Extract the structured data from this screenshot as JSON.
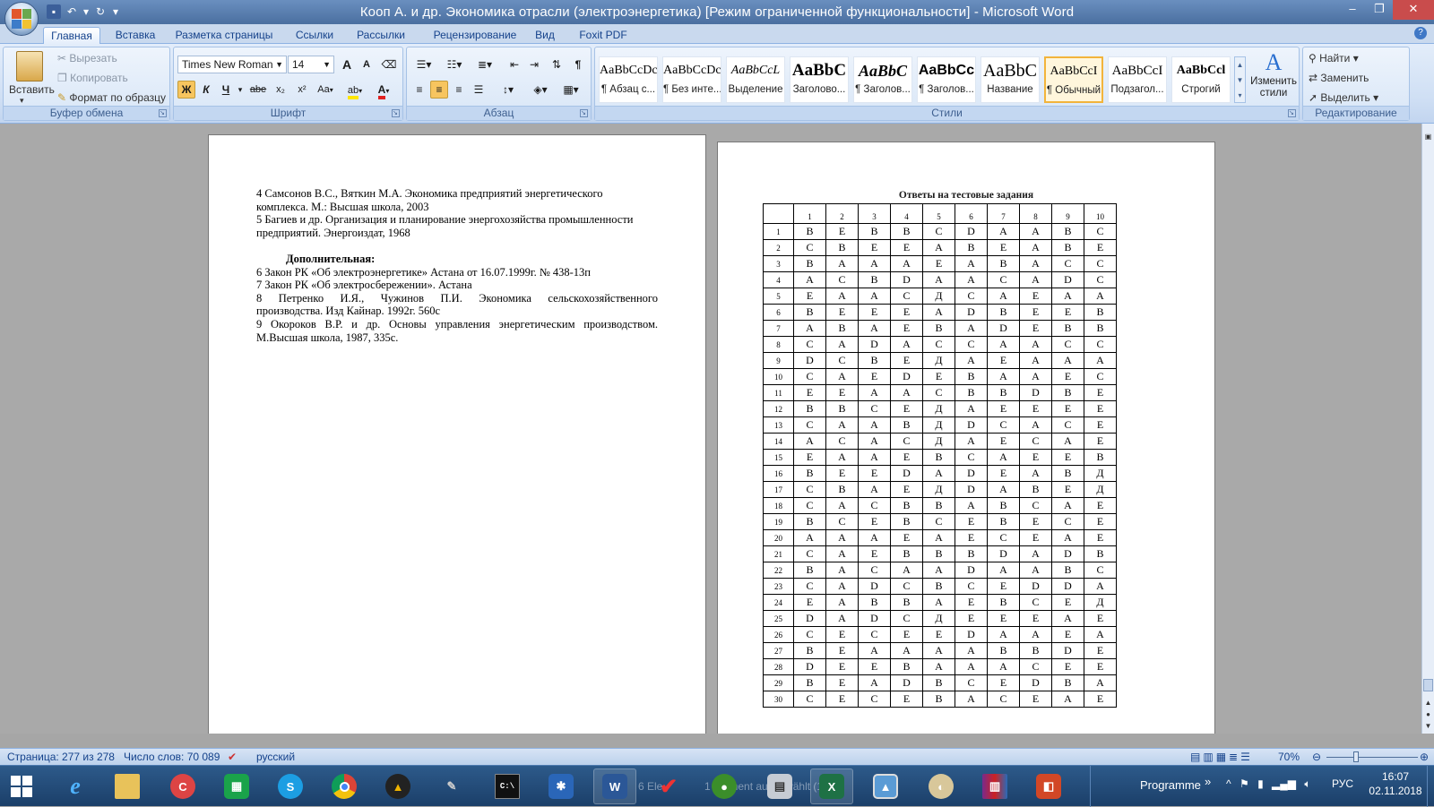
{
  "window": {
    "title": "Кооп А. и др. Экономика отрасли (электроэнергетика) [Режим ограниченной функциональности] - Microsoft Word",
    "buttons": [
      "–",
      "❐",
      "✕"
    ]
  },
  "tabs": [
    "Главная",
    "Вставка",
    "Разметка страницы",
    "Ссылки",
    "Рассылки",
    "Рецензирование",
    "Вид",
    "Foxit PDF"
  ],
  "clipboard": {
    "paste": "Вставить",
    "cut": "Вырезать",
    "copy": "Копировать",
    "format_painter": "Формат по образцу",
    "label": "Буфер обмена"
  },
  "font": {
    "name": "Times New Roman",
    "size": "14",
    "label": "Шрифт",
    "bold": "Ж",
    "italic": "К",
    "underline": "Ч",
    "strike": "abe",
    "sub": "x₂",
    "sup": "x²",
    "case": "Aa",
    "grow": "A",
    "shrink": "A"
  },
  "paragraph": {
    "label": "Абзац",
    "pilcrow": "¶"
  },
  "styles": {
    "label": "Стили",
    "items": [
      {
        "preview": "AaBbCcDc",
        "name": "¶ Абзац с..."
      },
      {
        "preview": "AaBbCcDc",
        "name": "¶ Без инте..."
      },
      {
        "preview": "AaBbCcL",
        "name": "Выделение"
      },
      {
        "preview": "AaBbC",
        "name": "Заголово..."
      },
      {
        "preview": "AaBbC",
        "name": "¶ Заголов..."
      },
      {
        "preview": "AaBbCc",
        "name": "¶ Заголов..."
      },
      {
        "preview": "AaBbC",
        "name": "Название"
      },
      {
        "preview": "AaBbCcI",
        "name": "¶ Обычный"
      },
      {
        "preview": "AaBbCcI",
        "name": "Подзагол..."
      },
      {
        "preview": "AaBbCcl",
        "name": "Строгий"
      }
    ],
    "change_styles": "Изменить стили"
  },
  "editing": {
    "label": "Редактирование",
    "find": "Найти",
    "replace": "Заменить",
    "select": "Выделить"
  },
  "left_page": {
    "line1": "4 Самсонов В.С., Вяткин М.А. Экономика предприятий энергетического",
    "line2": "комплекса. М.: Высшая школа, 2003",
    "line3": "5 Багиев и др. Организация и планирование энергохозяйства промышленности",
    "line4": "предприятий. Энергоиздат, 1968",
    "heading": "Дополнительная:",
    "line6": "6 Закон РК «Об электроэнергетике» Астана от 16.07.1999г. № 438-13п",
    "line7": "7 Закон РК «Об электросбережении». Астана",
    "line8a": "8 Петренко И.Я., Чужинов П.И. Экономика сельскохозяйственного",
    "line8b": "производства. Изд Кайнар. 1992г. 560с",
    "line9a": "9 Окороков В.Р. и др. Основы управления энергетическим производством.",
    "line9b": "М.Высшая школа, 1987, 335с."
  },
  "right_page": {
    "table_title": "Ответы на тестовые задания",
    "columns": [
      "1",
      "2",
      "3",
      "4",
      "5",
      "6",
      "7",
      "8",
      "9",
      "10"
    ],
    "rows": [
      [
        "1",
        "B",
        "E",
        "B",
        "B",
        "C",
        "D",
        "A",
        "A",
        "B",
        "C"
      ],
      [
        "2",
        "C",
        "B",
        "E",
        "E",
        "A",
        "B",
        "E",
        "A",
        "B",
        "E"
      ],
      [
        "3",
        "B",
        "A",
        "A",
        "A",
        "E",
        "A",
        "B",
        "A",
        "C",
        "C"
      ],
      [
        "4",
        "A",
        "C",
        "B",
        "D",
        "A",
        "A",
        "C",
        "A",
        "D",
        "C"
      ],
      [
        "5",
        "E",
        "A",
        "A",
        "C",
        "Д",
        "C",
        "A",
        "E",
        "A",
        "A"
      ],
      [
        "6",
        "B",
        "E",
        "E",
        "E",
        "A",
        "D",
        "B",
        "E",
        "E",
        "B"
      ],
      [
        "7",
        "A",
        "B",
        "A",
        "E",
        "B",
        "A",
        "D",
        "E",
        "B",
        "B"
      ],
      [
        "8",
        "C",
        "A",
        "D",
        "A",
        "C",
        "C",
        "A",
        "A",
        "C",
        "C"
      ],
      [
        "9",
        "D",
        "C",
        "B",
        "E",
        "Д",
        "A",
        "E",
        "A",
        "A",
        "A"
      ],
      [
        "10",
        "C",
        "A",
        "E",
        "D",
        "E",
        "B",
        "A",
        "A",
        "E",
        "C"
      ],
      [
        "11",
        "E",
        "E",
        "A",
        "A",
        "C",
        "B",
        "B",
        "D",
        "B",
        "E"
      ],
      [
        "12",
        "B",
        "B",
        "C",
        "E",
        "Д",
        "A",
        "E",
        "E",
        "E",
        "E"
      ],
      [
        "13",
        "C",
        "A",
        "A",
        "B",
        "Д",
        "D",
        "C",
        "A",
        "C",
        "E"
      ],
      [
        "14",
        "A",
        "C",
        "A",
        "C",
        "Д",
        "A",
        "E",
        "C",
        "A",
        "E"
      ],
      [
        "15",
        "E",
        "A",
        "A",
        "E",
        "B",
        "C",
        "A",
        "E",
        "E",
        "B"
      ],
      [
        "16",
        "B",
        "E",
        "E",
        "D",
        "A",
        "D",
        "E",
        "A",
        "B",
        "Д"
      ],
      [
        "17",
        "C",
        "B",
        "A",
        "E",
        "Д",
        "D",
        "A",
        "B",
        "E",
        "Д"
      ],
      [
        "18",
        "C",
        "A",
        "C",
        "B",
        "B",
        "A",
        "B",
        "C",
        "A",
        "E"
      ],
      [
        "19",
        "B",
        "C",
        "E",
        "B",
        "C",
        "E",
        "B",
        "E",
        "C",
        "E"
      ],
      [
        "20",
        "A",
        "A",
        "A",
        "E",
        "A",
        "E",
        "C",
        "E",
        "A",
        "E"
      ],
      [
        "21",
        "C",
        "A",
        "E",
        "B",
        "B",
        "B",
        "D",
        "A",
        "D",
        "B"
      ],
      [
        "22",
        "B",
        "A",
        "C",
        "A",
        "A",
        "D",
        "A",
        "A",
        "B",
        "C"
      ],
      [
        "23",
        "C",
        "A",
        "D",
        "C",
        "B",
        "C",
        "E",
        "D",
        "D",
        "A"
      ],
      [
        "24",
        "E",
        "A",
        "B",
        "B",
        "A",
        "E",
        "B",
        "C",
        "E",
        "Д"
      ],
      [
        "25",
        "D",
        "A",
        "D",
        "C",
        "Д",
        "E",
        "E",
        "E",
        "A",
        "E"
      ],
      [
        "26",
        "C",
        "E",
        "C",
        "E",
        "E",
        "D",
        "A",
        "A",
        "E",
        "A"
      ],
      [
        "27",
        "B",
        "E",
        "A",
        "A",
        "A",
        "A",
        "B",
        "B",
        "D",
        "E"
      ],
      [
        "28",
        "D",
        "E",
        "E",
        "B",
        "A",
        "A",
        "A",
        "C",
        "E",
        "E"
      ],
      [
        "29",
        "B",
        "E",
        "A",
        "D",
        "B",
        "C",
        "E",
        "D",
        "B",
        "A"
      ],
      [
        "30",
        "C",
        "E",
        "C",
        "E",
        "B",
        "A",
        "C",
        "E",
        "A",
        "E"
      ]
    ]
  },
  "status": {
    "page": "Страница: 277 из 278",
    "words": "Число слов: 70 089",
    "lang": "русский",
    "zoom": "70%"
  },
  "taskbar": {
    "ghost1": "6 Ele",
    "ghost2": "1 Element ausgewählt (1,33",
    "programme": "Programme",
    "chevron": "»",
    "lang": "РУС",
    "time": "16:07",
    "date": "02.11.2018"
  },
  "colors": {
    "title_bar": "#4a6fa0",
    "ribbon": "#cfdff4",
    "taskbar": "#1b3f69",
    "selected_style": "#f2b43c"
  }
}
